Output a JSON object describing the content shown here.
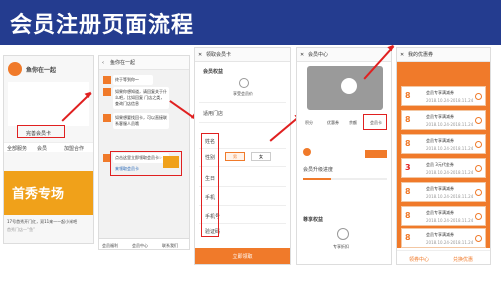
{
  "page": {
    "title": "会员注册页面流程"
  },
  "screen1": {
    "store_name": "鱼你在一起",
    "register_link": "完善会员卡",
    "nav": [
      "全部服务",
      "会员",
      "加盟合作"
    ],
    "banner_text": "首秀专场",
    "promo_text": "17号首秀开门红，双11来一一起小米吧",
    "promo_sub": "首秀门店一“鱼”"
  },
  "screen2": {
    "title": "鱼你在一起",
    "msg1": "终于等到你～",
    "msg2": "如果你想知道，请回复关于什么吧，比如回复 门店之类，查询门店信息",
    "msg3": "如果想要找回卡，可以直接联系客服人员哦",
    "msg4": "点击这里立即领取会员卡☞",
    "link_text": "来领取会员卡",
    "bottom_nav": [
      "会员福利",
      "会员中心",
      "联系我们"
    ]
  },
  "screen3": {
    "title": "领取会员卡",
    "section": "会员权益",
    "benefit": "享受会员价",
    "store_label": "适用门店",
    "fields": [
      "姓名",
      "性别",
      "生日",
      "手机",
      "手机号",
      "验证码"
    ],
    "gender_options": [
      "男",
      "女"
    ],
    "submit": "立即领取"
  },
  "screen4": {
    "title": "会员中心",
    "stats": [
      "积分",
      "优惠券",
      "余额",
      "会员卡"
    ],
    "highlight": "优惠券",
    "level_text": "会员升级进度",
    "section2": "尊享权益",
    "benefit2": "专享折扣"
  },
  "screen5": {
    "title": "我的优惠券",
    "coupons": [
      {
        "value": "8",
        "name": "会员专享满减券",
        "date": "2018.10.24-2018.11.24"
      },
      {
        "value": "8",
        "name": "会员专享满减券",
        "date": "2018.10.24-2018.11.24"
      },
      {
        "value": "8",
        "name": "会员专享满减券",
        "date": "2018.10.24-2018.11.24"
      },
      {
        "value": "3",
        "name": "会员 3元代金券",
        "date": "2018.10.24-2018.11.24"
      },
      {
        "value": "8",
        "name": "会员专享满减券",
        "date": "2018.10.24-2018.11.24"
      },
      {
        "value": "8",
        "name": "会员专享满减券",
        "date": "2018.10.24-2018.11.24"
      },
      {
        "value": "8",
        "name": "会员专享满减券",
        "date": "2018.10.24-2018.11.24"
      }
    ],
    "bottom": [
      "领券中心",
      "兑换优惠"
    ]
  },
  "colors": {
    "header": "#243c8f",
    "accent": "#f07a2a",
    "annotation": "#e02020"
  }
}
